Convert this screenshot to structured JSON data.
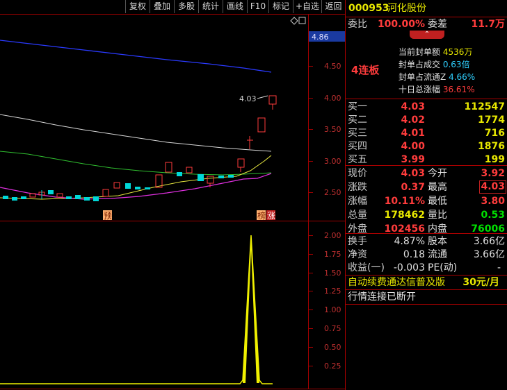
{
  "toolbar": {
    "items": [
      "复权",
      "叠加",
      "多股",
      "统计",
      "画线",
      "F10",
      "标记",
      "+自选",
      "返回"
    ]
  },
  "chart": {
    "price_ticks": [
      "4.50",
      "4.00",
      "3.50",
      "3.00",
      "2.50"
    ],
    "current_price_tag": "4.86",
    "high_label": "4.03",
    "marker_pre": "预",
    "marker_list": "榜",
    "marker_up": "涨",
    "indicator_ticks": [
      "2.00",
      "1.75",
      "1.50",
      "1.25",
      "1.00",
      "0.75",
      "0.50",
      "0.25"
    ]
  },
  "panel": {
    "stock_code": "000953",
    "stock_name": "河化股份",
    "weibi_label": "委比",
    "weibi_value": "100.00%",
    "weicha_label": "委差",
    "weicha_value": "11.7万",
    "streak": "4连板",
    "seal": [
      {
        "label": "当前封单额",
        "value": "4536万"
      },
      {
        "label": "封单占成交",
        "value": "0.63倍"
      },
      {
        "label": "封单占流通Z",
        "value": "4.66%"
      },
      {
        "label": "十日总涨幅",
        "value": "36.61%"
      }
    ],
    "bids": [
      {
        "label": "买一",
        "price": "4.03",
        "vol": "112547"
      },
      {
        "label": "买二",
        "price": "4.02",
        "vol": "1774"
      },
      {
        "label": "买三",
        "price": "4.01",
        "vol": "716"
      },
      {
        "label": "买四",
        "price": "4.00",
        "vol": "1876"
      },
      {
        "label": "买五",
        "price": "3.99",
        "vol": "199"
      }
    ],
    "quote": {
      "xianjia_label": "现价",
      "xianjia": "4.03",
      "jinkai_label": "今开",
      "jinkai": "3.92",
      "zhangdie_label": "涨跌",
      "zhangdie": "0.37",
      "zuigao_label": "最高",
      "zuigao": "4.03",
      "zhangfu_label": "涨幅",
      "zhangfu": "10.11%",
      "zuidi_label": "最低",
      "zuidi": "3.80",
      "zongliang_label": "总量",
      "zongliang": "178462",
      "liangbi_label": "量比",
      "liangbi": "0.53",
      "waipan_label": "外盘",
      "waipan": "102456",
      "neipan_label": "内盘",
      "neipan": "76006"
    },
    "fund": {
      "huanshou_label": "换手",
      "huanshou": "4.87%",
      "guben_label": "股本",
      "guben": "3.66亿",
      "jingzi_label": "净资",
      "jingzi": "0.18",
      "liutong_label": "流通",
      "liutong": "3.66亿",
      "shouyi_label": "收益(一)",
      "shouyi": "-0.003",
      "pe_label": "PE(动)",
      "pe": "-"
    },
    "promo_text": "自动续费通达信普及版",
    "promo_price": "30元/月",
    "status": "行情连接已断开"
  },
  "colors": {
    "up": "#ff3c3c",
    "down": "#00e0e0",
    "axis": "#a00000"
  }
}
